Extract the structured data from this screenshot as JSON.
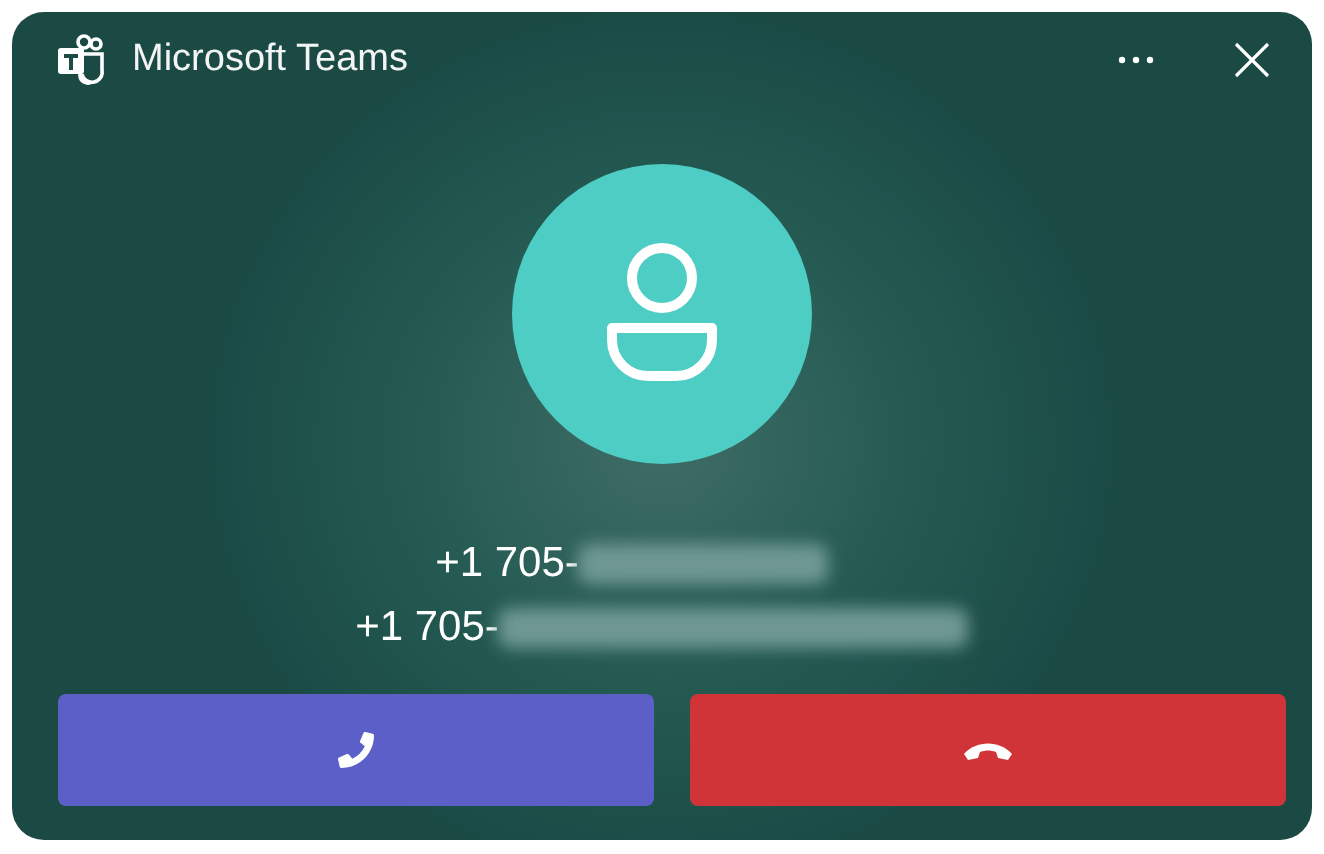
{
  "window": {
    "title": "Microsoft Teams"
  },
  "caller": {
    "lines": [
      {
        "text": "+1 705-",
        "redacted": true
      },
      {
        "text": "+1 705-",
        "redacted": true
      }
    ]
  },
  "actions": [
    {
      "kind": "accept"
    },
    {
      "kind": "decline"
    }
  ]
}
